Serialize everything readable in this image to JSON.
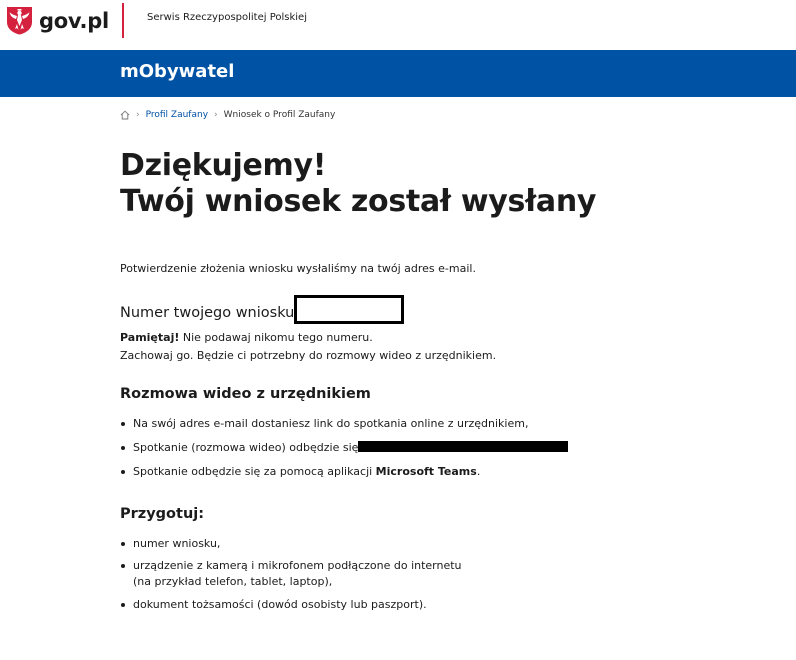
{
  "header": {
    "logo_text": "gov.pl",
    "service_name": "Serwis Rzeczypospolitej Polskiej",
    "app_name": "mObywatel"
  },
  "breadcrumb": {
    "items": [
      "Profil Zaufany",
      "Wniosek o Profil Zaufany"
    ]
  },
  "main": {
    "title_line1": "Dziękujemy!",
    "title_line2": "Twój wniosek został wysłany",
    "confirmation_text": "Potwierdzenie złożenia wniosku wysłaliśmy na twój adres e-mail.",
    "request_number_label": "Numer twojego wniosku",
    "remember_bold": "Pamiętaj!",
    "remember_text": " Nie podawaj nikomu tego numeru.",
    "keep_text": "Zachowaj go. Będzie ci potrzebny do rozmowy wideo z urzędnikiem."
  },
  "video_section": {
    "heading": "Rozmowa wideo z urzędnikiem",
    "items": [
      "Na swój adres e-mail dostaniesz link do spotkania online z urzędnikiem,",
      "Spotkanie (rozmowa wideo) odbędzie się",
      "Spotkanie odbędzie się za pomocą aplikacji "
    ],
    "teams_name": "Microsoft Teams",
    "teams_suffix": "."
  },
  "prepare_section": {
    "heading": "Przygotuj:",
    "items": [
      "numer wniosku,",
      "urządzenie z kamerą i mikrofonem podłączone do internetu",
      "(na przykład telefon, tablet, laptop),",
      "dokument tożsamości (dowód osobisty lub paszport)."
    ]
  },
  "colors": {
    "brand_blue": "#0052a5",
    "brand_red": "#d4213d"
  }
}
